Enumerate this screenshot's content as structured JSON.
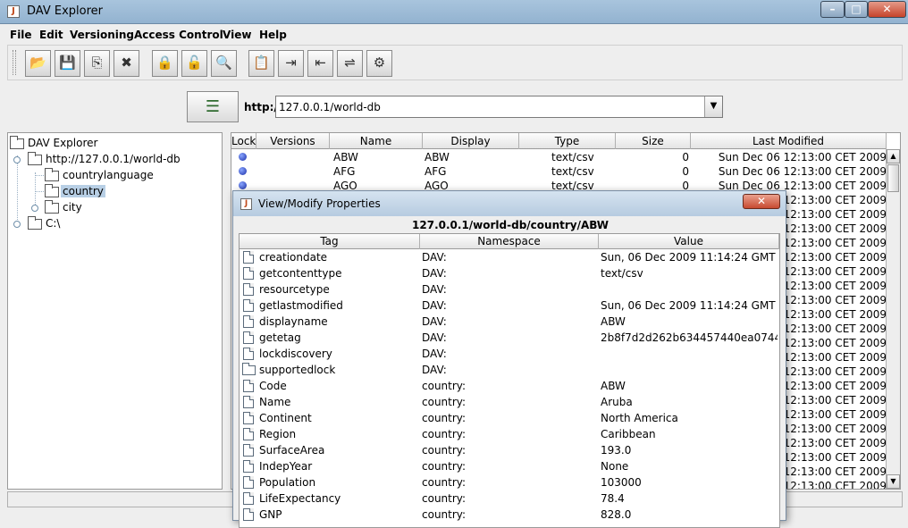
{
  "window": {
    "title": "DAV Explorer",
    "app_icon_glyph": "J",
    "minimize_glyph": "–",
    "maximize_glyph": "□",
    "close_glyph": "✕"
  },
  "menu": [
    "File",
    "Edit",
    "Versioning",
    "Access Control",
    "View",
    "Help"
  ],
  "toolbar": {
    "buttons": [
      {
        "name": "open-folder",
        "glyph": "📂"
      },
      {
        "name": "save",
        "glyph": "💾"
      },
      {
        "name": "copy",
        "glyph": "⎘"
      },
      {
        "name": "delete",
        "glyph": "✖"
      },
      {
        "name": "lock",
        "glyph": "🔒"
      },
      {
        "name": "unlock",
        "glyph": "🔓"
      },
      {
        "name": "view-properties",
        "glyph": "🔍"
      },
      {
        "name": "edit-properties",
        "glyph": "📋"
      },
      {
        "name": "checkin",
        "glyph": "⇥"
      },
      {
        "name": "checkout",
        "glyph": "⇤"
      },
      {
        "name": "version-report",
        "glyph": "⇌"
      },
      {
        "name": "acl",
        "glyph": "⚙"
      }
    ]
  },
  "url_bar": {
    "connect_glyph": "☰",
    "scheme_label": "http://",
    "value": "127.0.0.1/world-db",
    "dropdown_glyph": "▼"
  },
  "tree": {
    "items": [
      {
        "label": "DAV Explorer"
      },
      {
        "label": "http://127.0.0.1/world-db"
      },
      {
        "label": "countrylanguage"
      },
      {
        "label": "country"
      },
      {
        "label": "city"
      },
      {
        "label": "C:\\"
      }
    ]
  },
  "file_table": {
    "columns": [
      "Lock",
      "Versions",
      "Name",
      "Display",
      "Type",
      "Size",
      "Last Modified"
    ],
    "rows": [
      {
        "name": "ABW",
        "display": "ABW",
        "type": "text/csv",
        "size": "0",
        "modified": "Sun Dec 06 12:13:00 CET 2009"
      },
      {
        "name": "AFG",
        "display": "AFG",
        "type": "text/csv",
        "size": "0",
        "modified": "Sun Dec 06 12:13:00 CET 2009"
      },
      {
        "name": "AGO",
        "display": "AGO",
        "type": "text/csv",
        "size": "0",
        "modified": "Sun Dec 06 12:13:00 CET 2009"
      }
    ],
    "hidden_row_modified": "12:13:00 CET 2009",
    "scroll_up_glyph": "▲",
    "scroll_down_glyph": "▼"
  },
  "dialog": {
    "title": "View/Modify Properties",
    "close_glyph": "✕",
    "path": "127.0.0.1/world-db/country/ABW",
    "columns": [
      "Tag",
      "Namespace",
      "Value"
    ],
    "rows": [
      {
        "tag": "creationdate",
        "ns": "DAV:",
        "value": "Sun, 06 Dec 2009 11:14:24 GMT",
        "icon": "doc"
      },
      {
        "tag": "getcontenttype",
        "ns": "DAV:",
        "value": "text/csv",
        "icon": "doc"
      },
      {
        "tag": "resourcetype",
        "ns": "DAV:",
        "value": "",
        "icon": "doc"
      },
      {
        "tag": "getlastmodified",
        "ns": "DAV:",
        "value": "Sun, 06 Dec 2009 11:14:24 GMT",
        "icon": "doc"
      },
      {
        "tag": "displayname",
        "ns": "DAV:",
        "value": "ABW",
        "icon": "doc"
      },
      {
        "tag": "getetag",
        "ns": "DAV:",
        "value": "2b8f7d2d262b634457440ea0744...",
        "icon": "doc"
      },
      {
        "tag": "lockdiscovery",
        "ns": "DAV:",
        "value": "",
        "icon": "doc"
      },
      {
        "tag": "supportedlock",
        "ns": "DAV:",
        "value": "",
        "icon": "folder"
      },
      {
        "tag": "Code",
        "ns": "country:",
        "value": "ABW",
        "icon": "doc"
      },
      {
        "tag": "Name",
        "ns": "country:",
        "value": "Aruba",
        "icon": "doc"
      },
      {
        "tag": "Continent",
        "ns": "country:",
        "value": "North America",
        "icon": "doc"
      },
      {
        "tag": "Region",
        "ns": "country:",
        "value": "Caribbean",
        "icon": "doc"
      },
      {
        "tag": "SurfaceArea",
        "ns": "country:",
        "value": "193.0",
        "icon": "doc"
      },
      {
        "tag": "IndepYear",
        "ns": "country:",
        "value": "None",
        "icon": "doc"
      },
      {
        "tag": "Population",
        "ns": "country:",
        "value": "103000",
        "icon": "doc"
      },
      {
        "tag": "LifeExpectancy",
        "ns": "country:",
        "value": "78.4",
        "icon": "doc"
      },
      {
        "tag": "GNP",
        "ns": "country:",
        "value": "828.0",
        "icon": "doc"
      }
    ]
  }
}
